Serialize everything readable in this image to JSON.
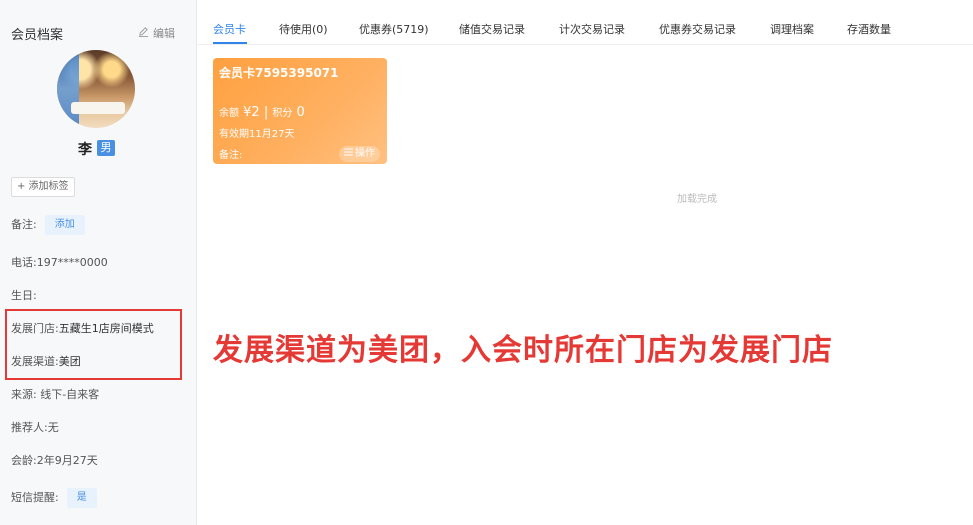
{
  "sidebar": {
    "title": "会员档案",
    "edit_label": "编辑",
    "member_name": "李",
    "gender": "男",
    "add_tag_label": "+ 添加标签",
    "remark_label": "备注:",
    "remark_add_label": "添加",
    "phone": "电话:197****0000",
    "birthday": "生日:",
    "dev_store_label": "发展门店:",
    "dev_store_value": "五藏生1店房间模式",
    "dev_channel_label": "发展渠道:",
    "dev_channel_value": "美团",
    "source": "来源: 线下-自来客",
    "referrer": "推荐人:无",
    "member_age": "会龄:2年9月27天",
    "sms_label": "短信提醒:",
    "sms_value": "是"
  },
  "tabs": [
    {
      "label": "会员卡"
    },
    {
      "label": "待使用(0)"
    },
    {
      "label": "优惠券(5719)"
    },
    {
      "label": "储值交易记录"
    },
    {
      "label": "计次交易记录"
    },
    {
      "label": "优惠券交易记录"
    },
    {
      "label": "调理档案"
    },
    {
      "label": "存酒数量"
    }
  ],
  "card": {
    "title": "会员卡7595395071",
    "balance_label": "余额",
    "balance_value": "¥2",
    "points_label": "积分",
    "points_value": "0",
    "expire": "有效期11月27天",
    "note": "备注:",
    "operate_label": "操作"
  },
  "status": {
    "loaded": "加载完成"
  },
  "annotation": "发展渠道为美团，入会时所在门店为发展门店",
  "colors": {
    "accent": "#2f86e8",
    "card_orange": "#ffa040",
    "annotation_red": "#e53935"
  }
}
